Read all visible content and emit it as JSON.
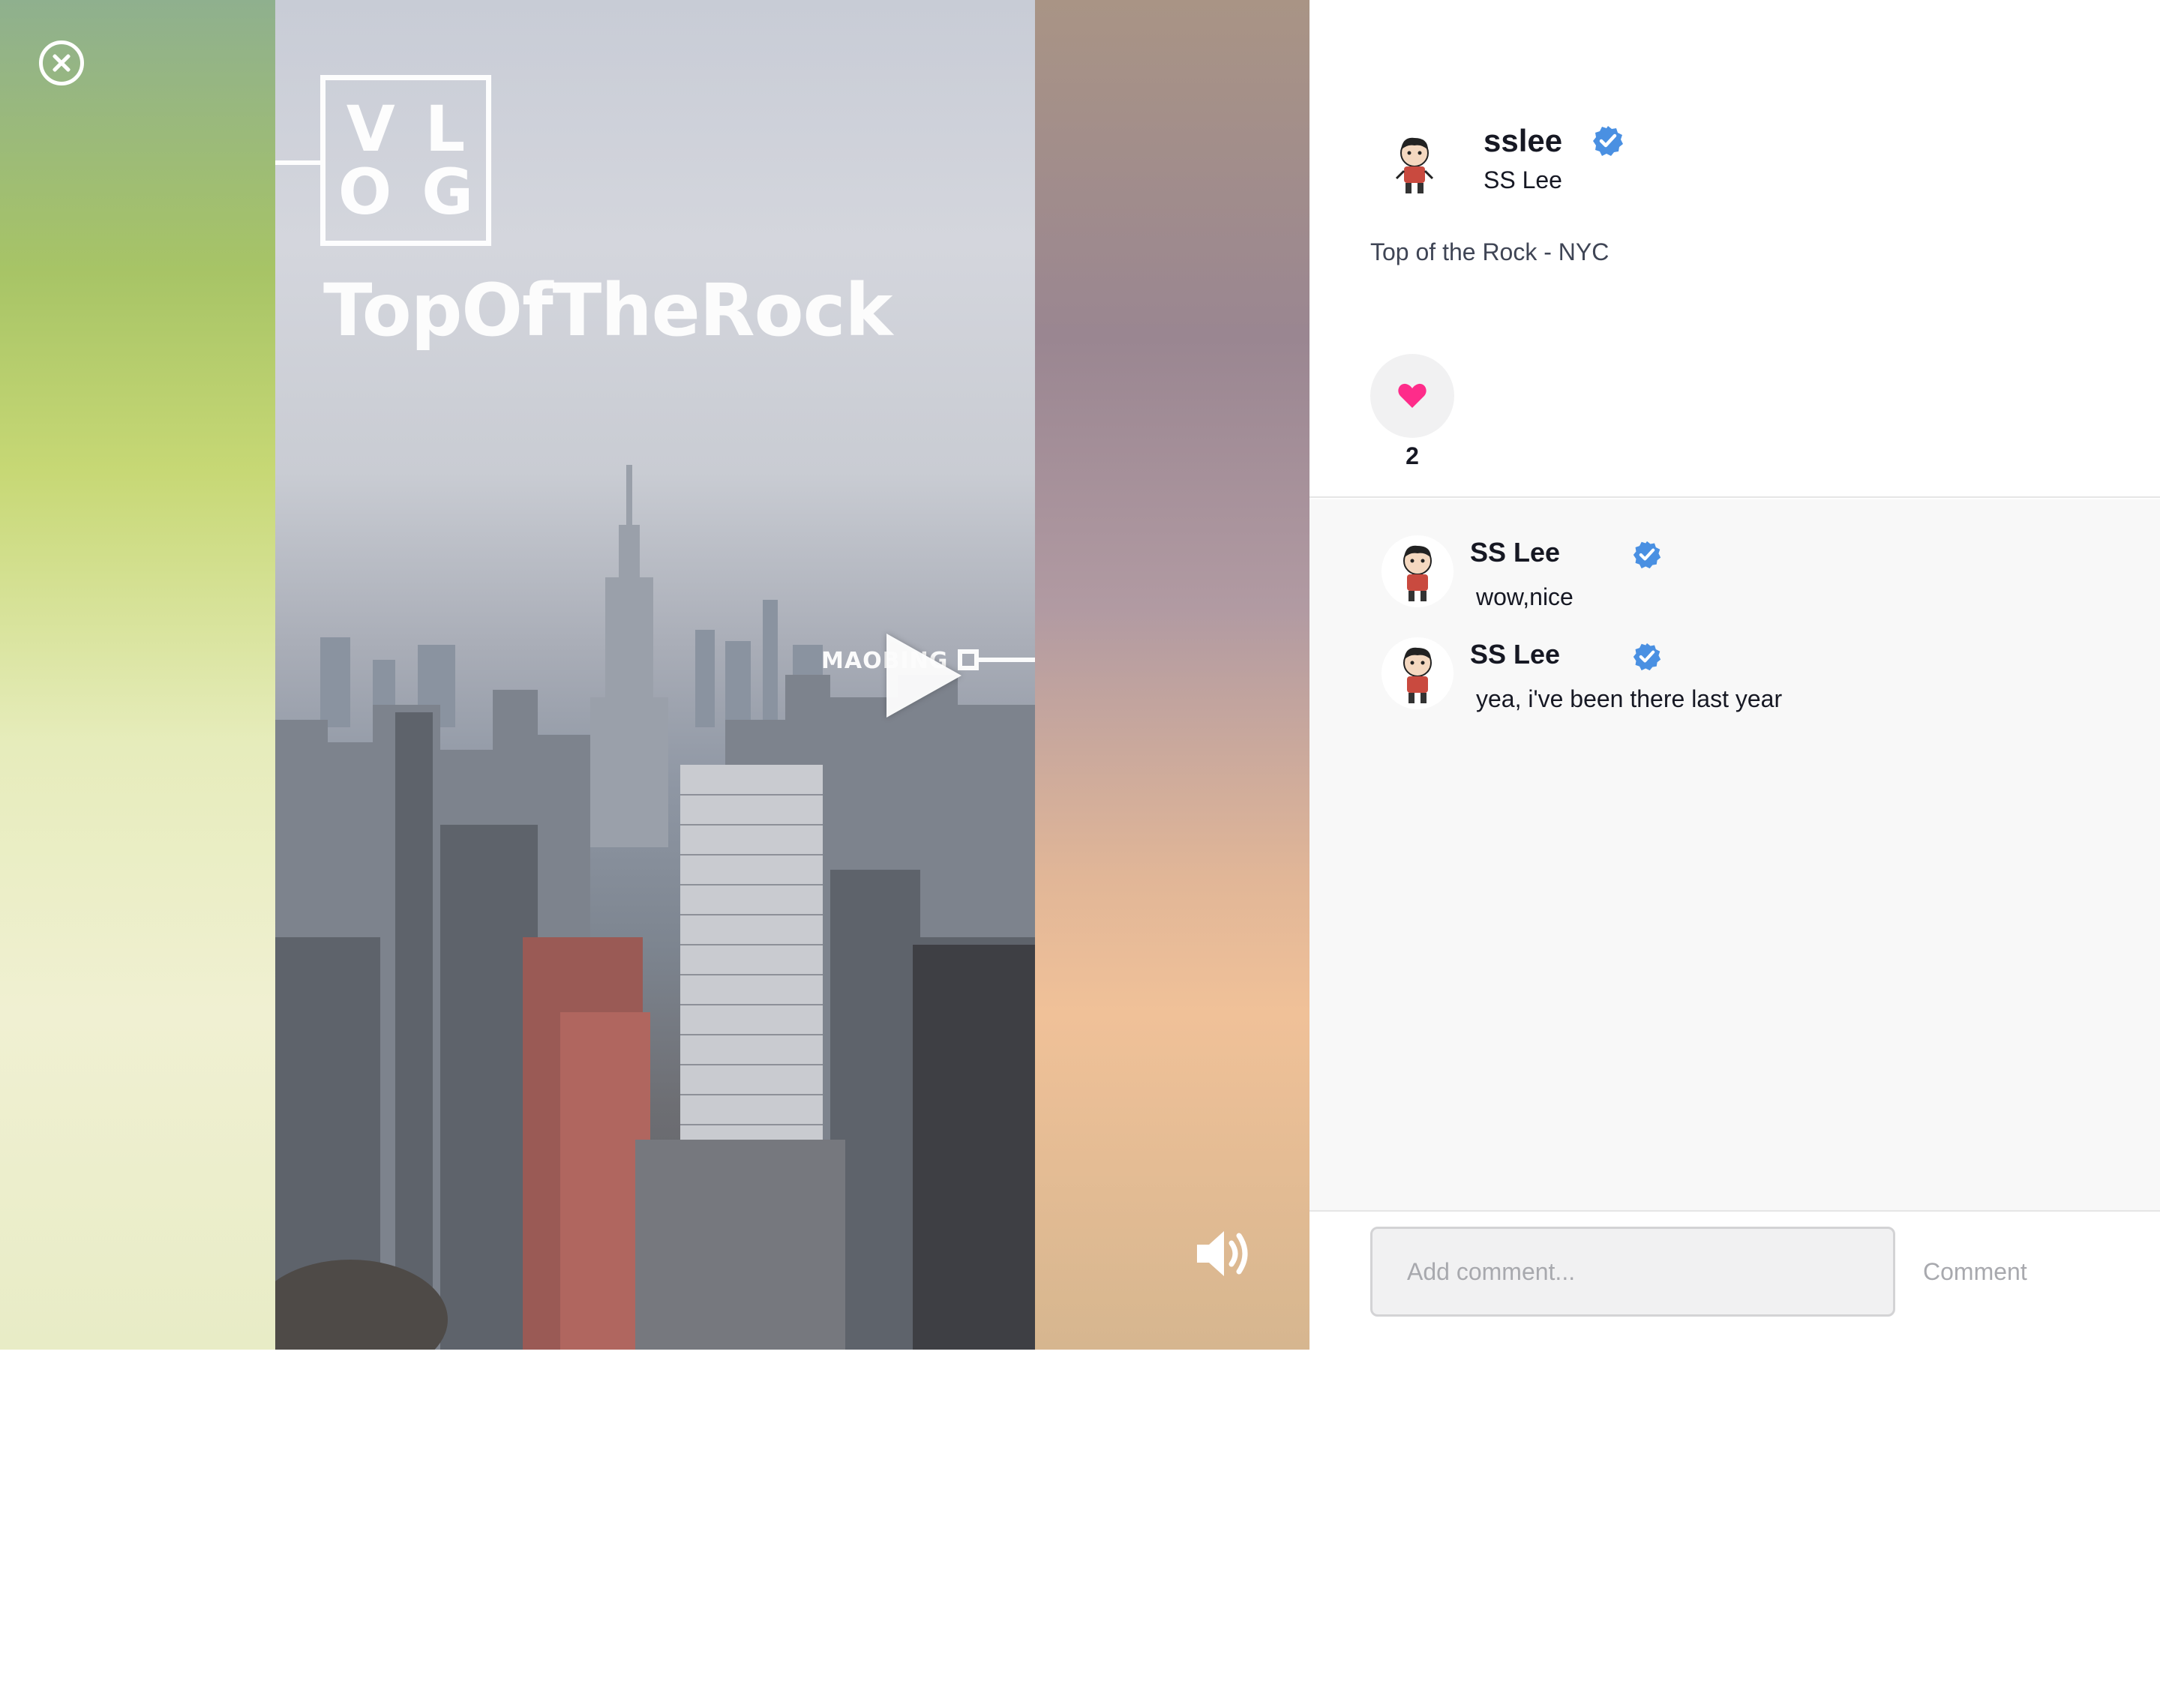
{
  "video": {
    "vlog_line1": "VL",
    "vlog_line2": "OG",
    "title": "TopOfTheRock",
    "watermark": "MAOBING"
  },
  "icons": {
    "close": "close-circle-icon",
    "play": "play-icon",
    "volume": "volume-icon",
    "verified": "verified-badge-icon",
    "like": "heart-icon"
  },
  "colors": {
    "like": "#fe2c55",
    "verified": "#20d5ec",
    "badge_blue": "#4a90e2"
  },
  "post": {
    "author_username": "sslee",
    "author_nickname": "SS Lee",
    "caption": "Top of the Rock - NYC",
    "like_count": "2"
  },
  "comments": [
    {
      "user": "SS Lee",
      "text": "wow,nice"
    },
    {
      "user": "SS Lee",
      "text": "yea, i've been there last year"
    }
  ],
  "comment_bar": {
    "placeholder": "Add comment...",
    "submit_label": "Comment"
  }
}
